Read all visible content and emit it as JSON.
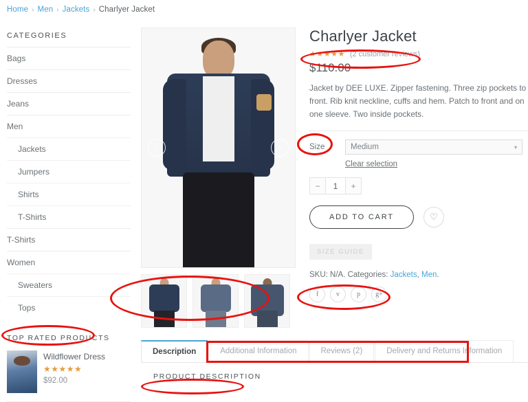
{
  "breadcrumb": {
    "items": [
      {
        "label": "Home",
        "link": true
      },
      {
        "label": "Men",
        "link": true
      },
      {
        "label": "Jackets",
        "link": true
      },
      {
        "label": "Charlyer Jacket",
        "link": false
      }
    ],
    "separator": "›"
  },
  "sidebar": {
    "categories_title": "CATEGORIES",
    "categories": [
      {
        "label": "Bags",
        "child": false
      },
      {
        "label": "Dresses",
        "child": false
      },
      {
        "label": "Jeans",
        "child": false
      },
      {
        "label": "Men",
        "child": false
      },
      {
        "label": "Jackets",
        "child": true
      },
      {
        "label": "Jumpers",
        "child": true
      },
      {
        "label": "Shirts",
        "child": true
      },
      {
        "label": "T-Shirts",
        "child": true
      },
      {
        "label": "T-Shirts",
        "child": false
      },
      {
        "label": "Women",
        "child": false
      },
      {
        "label": "Sweaters",
        "child": true
      },
      {
        "label": "Tops",
        "child": true
      }
    ],
    "top_rated_title": "TOP RATED PRODUCTS",
    "top_rated": [
      {
        "name": "Wildflower Dress",
        "stars": "★★★★★",
        "price": "$92.00"
      }
    ]
  },
  "gallery": {
    "prev_label": "‹",
    "next_label": "›",
    "thumbnails": [
      "thumbnail-front",
      "thumbnail-full-body",
      "thumbnail-back"
    ]
  },
  "product": {
    "title": "Charlyer Jacket",
    "stars": "★★★★★",
    "reviews_label": "(2 customer reviews)",
    "price": "$110.00",
    "description": "Jacket by DEE LUXE. Zipper fastening. Three zip pockets to front. Rib knit neckline, cuffs and hem. Patch to front and on one sleeve. Two inside pockets.",
    "size_label": "Size",
    "size_value": "Medium",
    "size_caret": "▾",
    "clear_selection": "Clear selection",
    "qty_minus": "−",
    "qty_value": "1",
    "qty_plus": "+",
    "add_to_cart": "ADD TO CART",
    "wishlist_icon": "♡",
    "size_guide": "SIZE GUIDE",
    "meta_prefix": "SKU: N/A. Categories: ",
    "category_links": [
      "Jackets",
      "Men"
    ],
    "meta_suffix": ".",
    "social": [
      {
        "name": "facebook",
        "glyph": "f"
      },
      {
        "name": "twitter",
        "glyph": "ᴠ"
      },
      {
        "name": "pinterest",
        "glyph": "p"
      },
      {
        "name": "googleplus",
        "glyph": "g+"
      }
    ]
  },
  "tabs": {
    "items": [
      {
        "label": "Description",
        "active": true
      },
      {
        "label": "Additional Information",
        "active": false
      },
      {
        "label": "Reviews (2)",
        "active": false
      },
      {
        "label": "Delivery and Returns Information",
        "active": false
      }
    ],
    "panel_title": "PRODUCT DESCRIPTION"
  },
  "colors": {
    "link": "#4aa3d8",
    "star": "#e79b3c",
    "annotation": "#e8120e",
    "text": "#6a7075"
  }
}
